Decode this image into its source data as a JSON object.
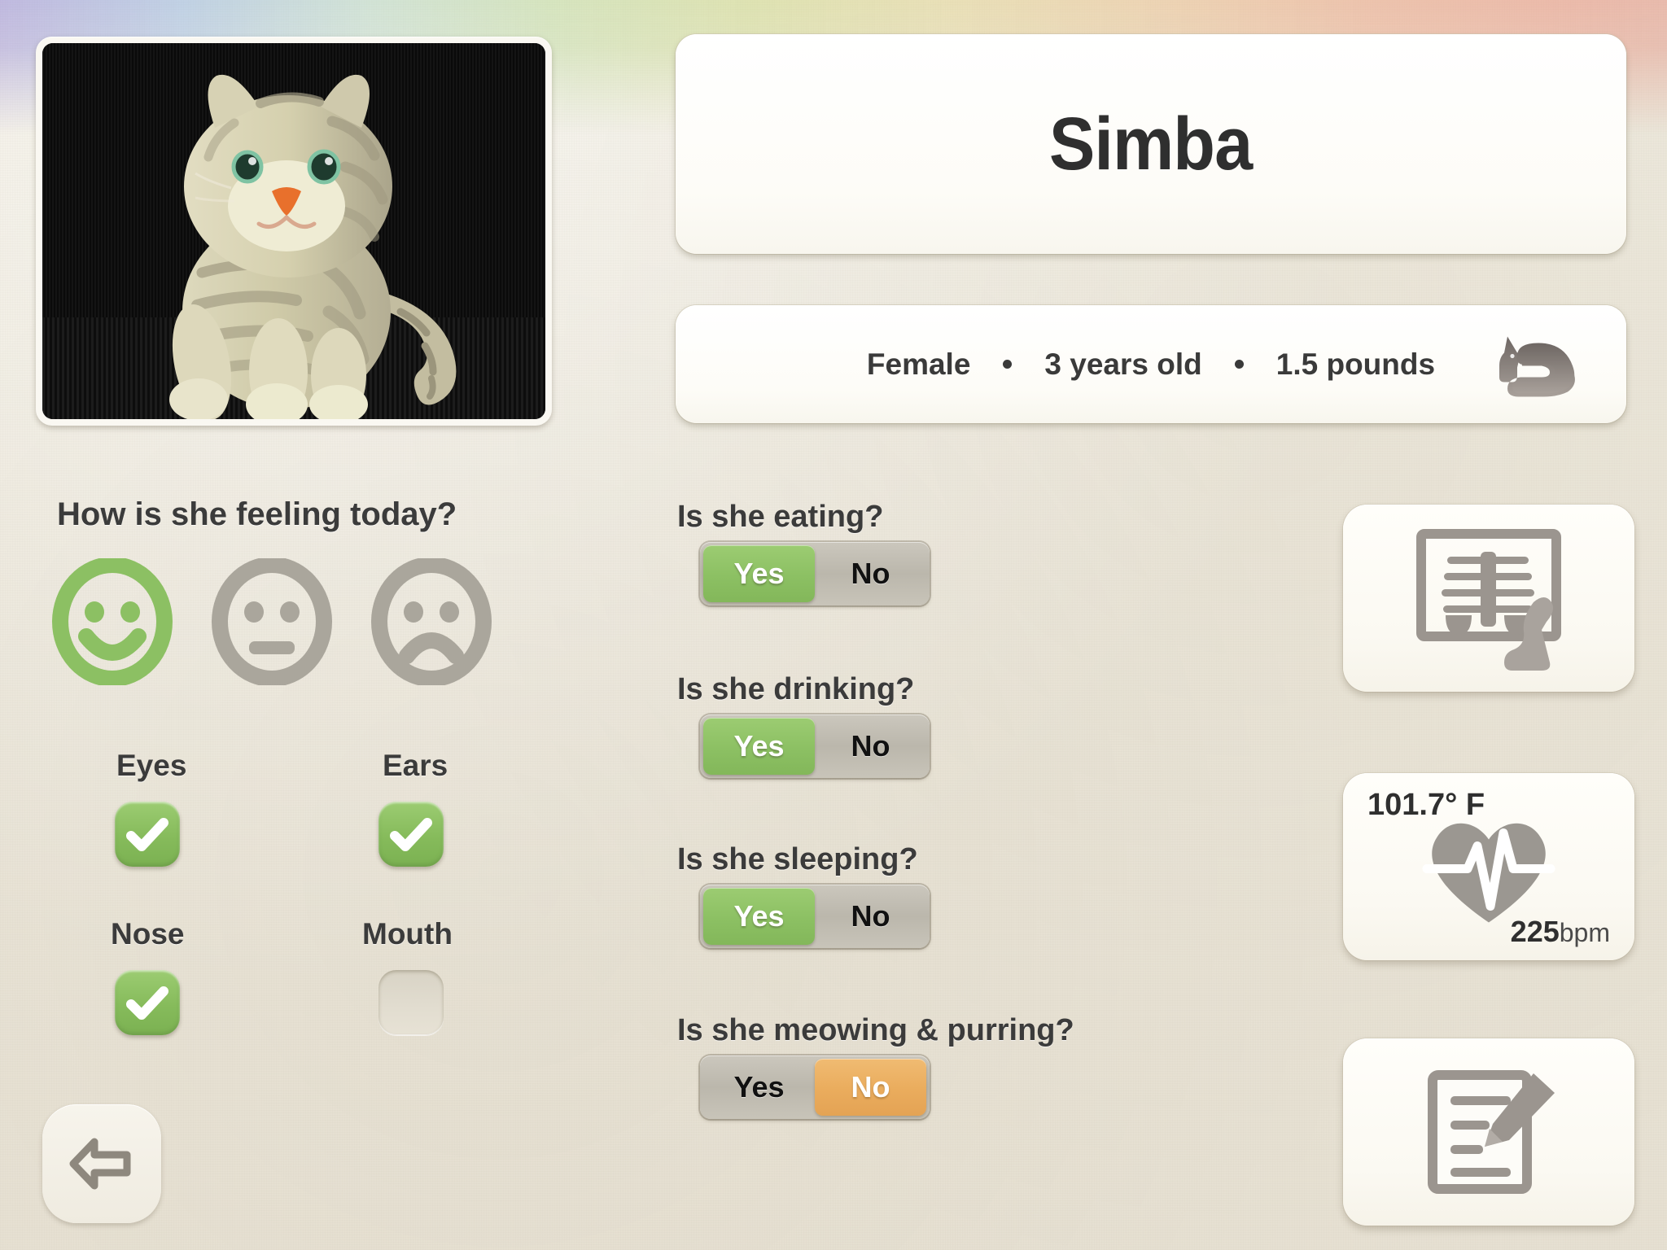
{
  "patient": {
    "name": "Simba",
    "sex": "Female",
    "age": "3 years old",
    "weight": "1.5 pounds",
    "species_icon": "cat-silhouette-icon",
    "photo_alt": "gray tabby plush cat"
  },
  "mood": {
    "question": "How is she feeling today?",
    "options": [
      {
        "id": "happy",
        "icon": "happy-face-icon",
        "selected": true
      },
      {
        "id": "neutral",
        "icon": "neutral-face-icon",
        "selected": false
      },
      {
        "id": "sad",
        "icon": "sad-face-icon",
        "selected": false
      }
    ],
    "selected_color": "#8cc063",
    "unselected_color": "#aaa69c"
  },
  "body_checks": [
    {
      "label": "Eyes",
      "checked": true
    },
    {
      "label": "Ears",
      "checked": true
    },
    {
      "label": "Nose",
      "checked": true
    },
    {
      "label": "Mouth",
      "checked": false
    }
  ],
  "questions": [
    {
      "label": "Is she eating?",
      "yes": "Yes",
      "no": "No",
      "answer": "yes",
      "answer_color": "#8cc063"
    },
    {
      "label": "Is she drinking?",
      "yes": "Yes",
      "no": "No",
      "answer": "yes",
      "answer_color": "#8cc063"
    },
    {
      "label": "Is she sleeping?",
      "yes": "Yes",
      "no": "No",
      "answer": "yes",
      "answer_color": "#8cc063"
    },
    {
      "label": "Is she meowing & purring?",
      "yes": "Yes",
      "no": "No",
      "answer": "no",
      "answer_color": "#eaac5d"
    }
  ],
  "tools": {
    "xray": {
      "icon": "xray-film-icon"
    },
    "vitals": {
      "temperature": "101.7° F",
      "heart_rate": "225",
      "heart_rate_unit": "bpm",
      "icon": "heart-pulse-icon"
    },
    "notes": {
      "icon": "notes-pencil-icon"
    }
  },
  "nav": {
    "back": {
      "icon": "arrow-left-icon"
    }
  }
}
